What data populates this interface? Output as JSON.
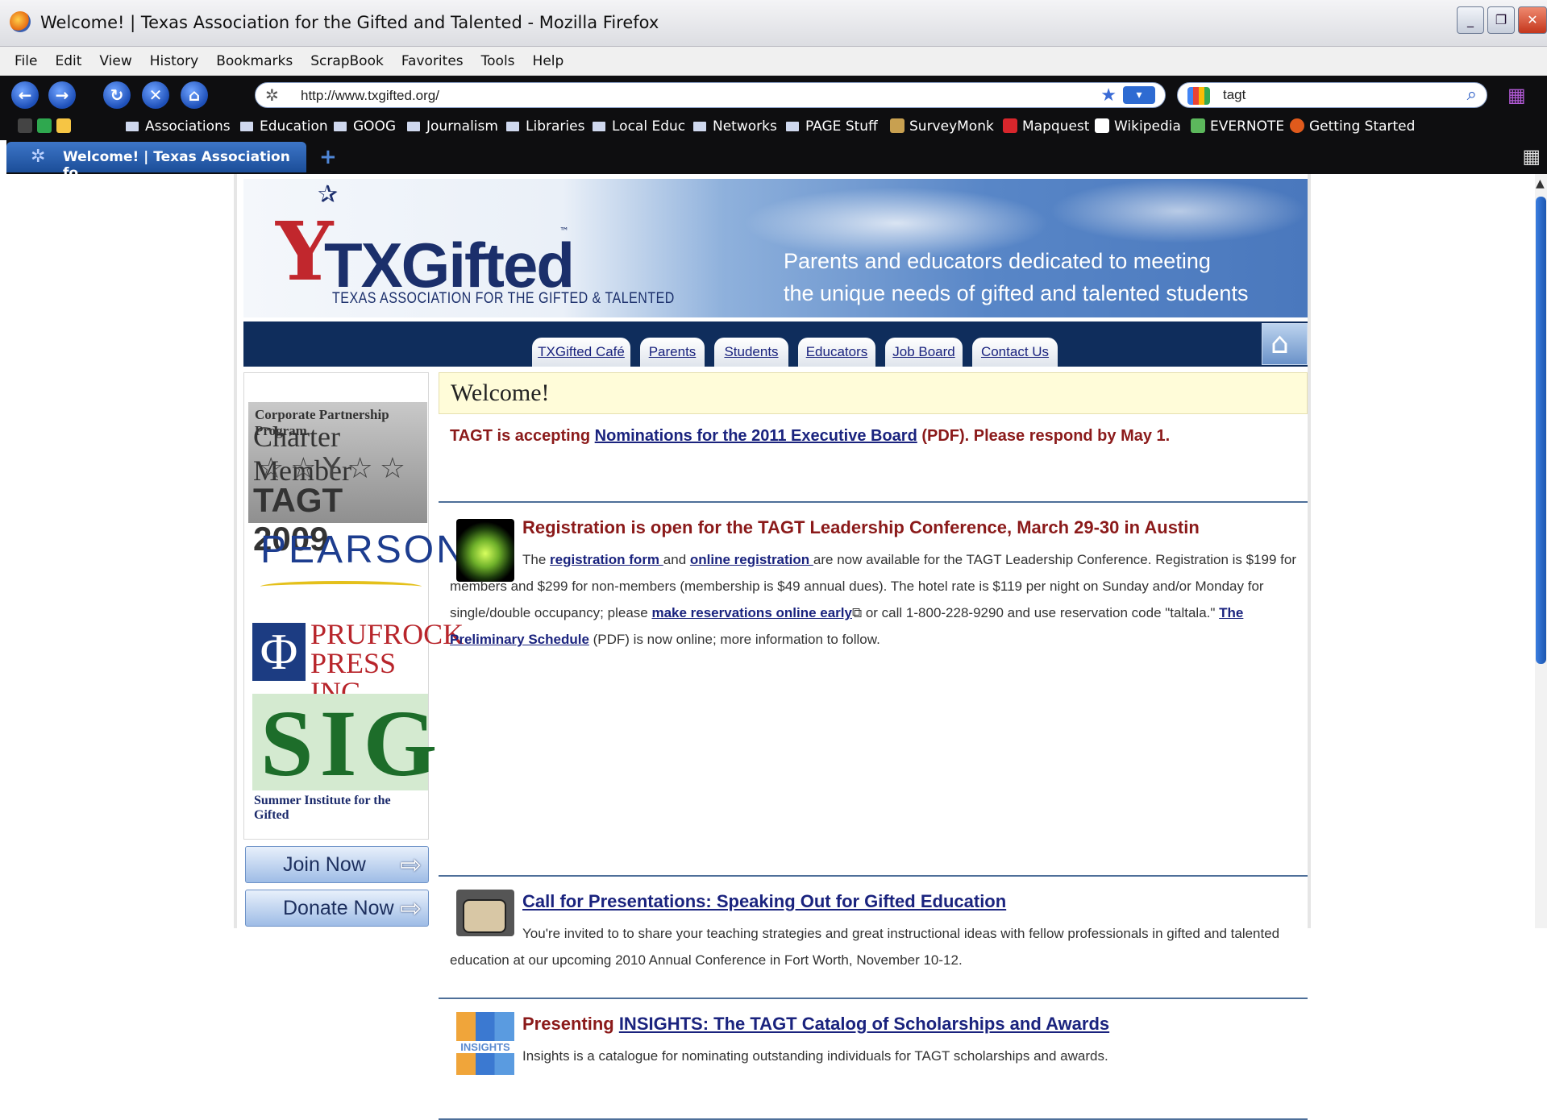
{
  "window": {
    "title": "Welcome! | Texas Association for the Gifted and Talented - Mozilla Firefox"
  },
  "menu": [
    "File",
    "Edit",
    "View",
    "History",
    "Bookmarks",
    "ScrapBook",
    "Favorites",
    "Tools",
    "Help"
  ],
  "address": {
    "url": "http://www.txgifted.org/"
  },
  "search": {
    "query": "tagt"
  },
  "bookmarks": [
    "Associations",
    "Education",
    "GOOG",
    "Journalism",
    "Libraries",
    "Local Educ",
    "Networks",
    "PAGE Stuff",
    "SurveyMonk",
    "Mapquest",
    "Wikipedia",
    "EVERNOTE",
    "Getting Started"
  ],
  "tab": {
    "label": "Welcome! | Texas Association fo..."
  },
  "site": {
    "logo_name": "TXGifted",
    "logo_tm": "™",
    "logo_sub": "TEXAS ASSOCIATION FOR THE GIFTED & TALENTED",
    "tagline_1": "Parents and educators dedicated to meeting",
    "tagline_2": "the unique needs of gifted and talented students",
    "nav": [
      "TXGifted Café",
      "Parents",
      "Students",
      "Educators",
      "Job Board",
      "Contact Us"
    ]
  },
  "sidebar": {
    "tagt_line1": "Corporate Partnership Program",
    "tagt_line2": "Charter Member",
    "tagt_line3": "TAGT 2009",
    "pearson": "PEARSON",
    "prufrock": "PRUFROCK PRESS INC.",
    "prufrock_tm": "™",
    "sig": "SIG",
    "sig_caption": "Summer Institute for the Gifted",
    "join": "Join Now",
    "donate": "Donate Now"
  },
  "main": {
    "welcome": "Welcome!",
    "announce_pre": "TAGT is accepting ",
    "announce_link": "Nominations for the 2011 Executive Board",
    "announce_post": " (PDF). Please respond by May 1.",
    "items": [
      {
        "head": "Registration is open for the TAGT Leadership Conference, March 29-30 in Austin",
        "t1": "The ",
        "l1": "registration form ",
        "t2": "and ",
        "l2": "online registration ",
        "t3": "are now available for the TAGT Leadership Conference. Registration is $199 for members and $299 for non-members (membership is $49 annual dues). The hotel rate is $119 per night on Sunday and/or Monday for single/double occupancy; please ",
        "l3": "make reservations online early",
        "t4": " or call 1-800-228-9290 and use reservation code \"taltala.\" ",
        "l4": "The Preliminary Schedule",
        "t5": " (PDF) is now online; more information to follow."
      },
      {
        "head_link": "Call for Presentations: Speaking Out for Gifted Education",
        "body": "You're invited to to share your teaching strategies and great instructional ideas with fellow professionals in gifted and talented education at our upcoming 2010 Annual Conference in Fort Worth, November 10-12."
      },
      {
        "head_pre": "Presenting ",
        "head_link": "INSIGHTS: The TAGT Catalog of Scholarships and Awards",
        "thumb_label": "INSIGHTS",
        "body": "Insights is a catalogue for nominating outstanding individuals for TAGT scholarships and awards."
      }
    ]
  }
}
